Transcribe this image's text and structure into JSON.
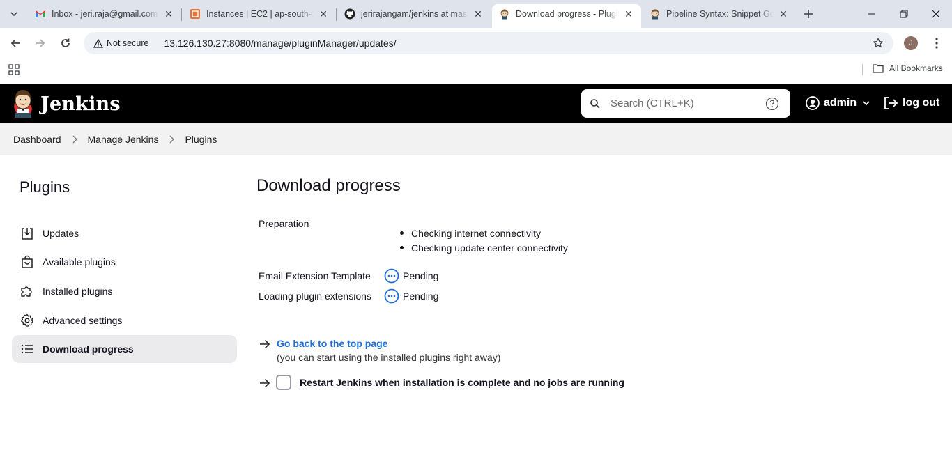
{
  "browser": {
    "tabs": [
      {
        "title": "Inbox - jeri.raja@gmail.com",
        "icon": "gmail-icon"
      },
      {
        "title": "Instances | EC2 | ap-south-1",
        "icon": "aws-icon"
      },
      {
        "title": "jerirajangam/jenkins at master",
        "icon": "github-icon"
      },
      {
        "title": "Download progress - Plugins",
        "icon": "jenkins-icon",
        "active": true
      },
      {
        "title": "Pipeline Syntax: Snippet Generator",
        "icon": "jenkins-icon"
      }
    ],
    "security_chip": "Not secure",
    "url": "13.126.130.27:8080/manage/pluginManager/updates/",
    "profile_initial": "J",
    "all_bookmarks": "All Bookmarks"
  },
  "header": {
    "brand": "Jenkins",
    "search_placeholder": "Search (CTRL+K)",
    "user": "admin",
    "logout": "log out"
  },
  "breadcrumbs": [
    "Dashboard",
    "Manage Jenkins",
    "Plugins"
  ],
  "sidebar": {
    "title": "Plugins",
    "items": [
      {
        "label": "Updates",
        "icon": "download-icon"
      },
      {
        "label": "Available plugins",
        "icon": "shopping-bag-icon"
      },
      {
        "label": "Installed plugins",
        "icon": "puzzle-icon"
      },
      {
        "label": "Advanced settings",
        "icon": "gear-icon"
      },
      {
        "label": "Download progress",
        "icon": "list-icon",
        "active": true
      }
    ]
  },
  "main": {
    "title": "Download progress",
    "preparation_label": "Preparation",
    "preparation_items": [
      "Checking internet connectivity",
      "Checking update center connectivity"
    ],
    "jobs": [
      {
        "name": "Email Extension Template",
        "status": "Pending"
      },
      {
        "name": "Loading plugin extensions",
        "status": "Pending"
      }
    ],
    "back_link": "Go back to the top page",
    "back_sub": "(you can start using the installed plugins right away)",
    "restart_label": "Restart Jenkins when installation is complete and no jobs are running"
  },
  "colors": {
    "header_bg": "#000000",
    "link": "#1e6fd6",
    "pending": "#1e6fd6",
    "breadcrumb_bg": "#f2f2f3"
  }
}
